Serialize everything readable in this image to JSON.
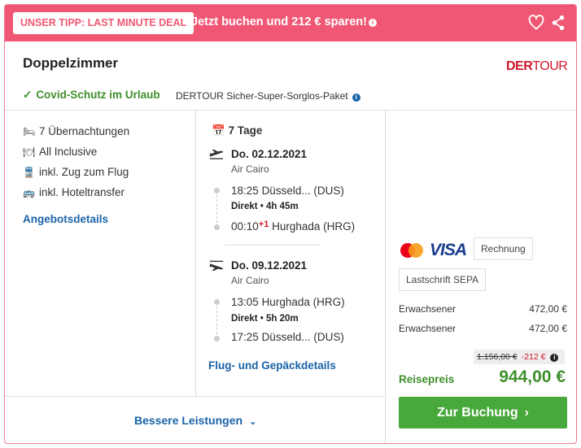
{
  "banner": {
    "tip_label": "UNSER TIPP: LAST MINUTE DEAL",
    "text": "Jetzt buchen und 212 € sparen!",
    "info_icon": "info-icon",
    "actions": [
      "heart-icon",
      "share-icon"
    ]
  },
  "header": {
    "room_type": "Doppelzimmer",
    "brand": "DERTOUR",
    "covid_label": "Covid-Schutz im Urlaub",
    "package_label": "DERTOUR Sicher-Super-Sorglos-Paket"
  },
  "amenities": [
    {
      "icon": "bed-icon",
      "label": "7 Übernachtungen"
    },
    {
      "icon": "cutlery-icon",
      "label": "All Inclusive"
    },
    {
      "icon": "train-icon",
      "label": "inkl. Zug zum Flug"
    },
    {
      "icon": "bus-icon",
      "label": "inkl. Hoteltransfer"
    }
  ],
  "offer_details_link": "Angebotsdetails",
  "better_services": "Bessere Leistungen",
  "flights": {
    "duration": "7 Tage",
    "outbound": {
      "date": "Do. 02.12.2021",
      "airline": "Air Cairo",
      "dep_time": "18:25",
      "dep_city": "Düsseld...",
      "dep_code": "(DUS)",
      "direct": "Direkt",
      "flight_time": "4h 45m",
      "arr_time": "00:10",
      "day_offset": "+1",
      "arr_city": "Hurghada",
      "arr_code": "(HRG)"
    },
    "return": {
      "date": "Do. 09.12.2021",
      "airline": "Air Cairo",
      "dep_time": "13:05",
      "dep_city": "Hurghada",
      "dep_code": "(HRG)",
      "direct": "Direkt",
      "flight_time": "5h 20m",
      "arr_time": "17:25",
      "arr_city": "Düsseld...",
      "arr_code": "(DUS)"
    },
    "details_link": "Flug- und Gepäckdetails"
  },
  "payment": {
    "visa": "VISA",
    "invoice": "Rechnung",
    "sepa": "Lastschrift SEPA"
  },
  "pricing": {
    "rows": [
      {
        "label": "Erwachsener",
        "price": "472,00 €"
      },
      {
        "label": "Erwachsener",
        "price": "472,00 €"
      }
    ],
    "old_price": "1.156,00 €",
    "discount": "-212 €",
    "total_label": "Reisepreis",
    "total": "944,00 €",
    "cta": "Zur Buchung"
  },
  "colors": {
    "banner": "#f05774",
    "green": "#47a83b",
    "link": "#1a63a8",
    "brand_red": "#d0172b"
  }
}
